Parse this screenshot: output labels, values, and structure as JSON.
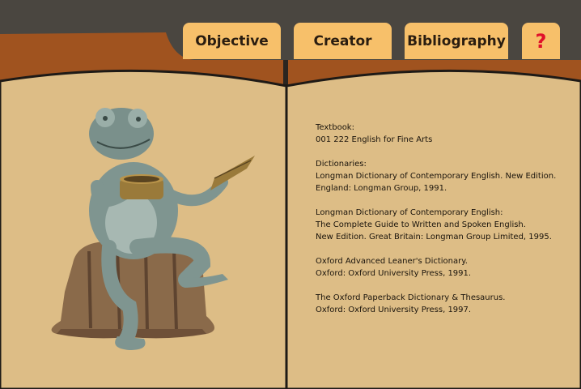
{
  "nav": {
    "tabs": [
      {
        "label": "Objective"
      },
      {
        "label": "Creator"
      },
      {
        "label": "Bibliography"
      },
      {
        "label": "?"
      }
    ]
  },
  "bibliography": {
    "textbook": {
      "heading": "Textbook:",
      "lines": [
        "001 222 English for Fine Arts"
      ]
    },
    "dictionaries": {
      "heading": "Dictionaries:",
      "lines": [
        "Longman Dictionary of Contemporary English. New Edition.",
        "England: Longman Group, 1991."
      ]
    },
    "entries": [
      {
        "lines": [
          "Longman Dictionary of Contemporary English:",
          "The Complete Guide to Written and Spoken English.",
          "New Edition. Great Britain: Longman Group Limited, 1995."
        ]
      },
      {
        "lines": [
          "Oxford Advanced Leaner's Dictionary.",
          "Oxford: Oxford University Press, 1991."
        ]
      },
      {
        "lines": [
          "The Oxford Paperback Dictionary & Thesaurus.",
          "Oxford: Oxford University Press, 1997."
        ]
      }
    ]
  },
  "illustration": {
    "icon": "frog-reading-statue-icon"
  },
  "colors": {
    "frame_dark": "#4a4640",
    "cover_brown": "#a0531f",
    "page_tan": "#ddbd86",
    "tab_orange": "#f7c06a",
    "help_red": "#e0102a"
  }
}
